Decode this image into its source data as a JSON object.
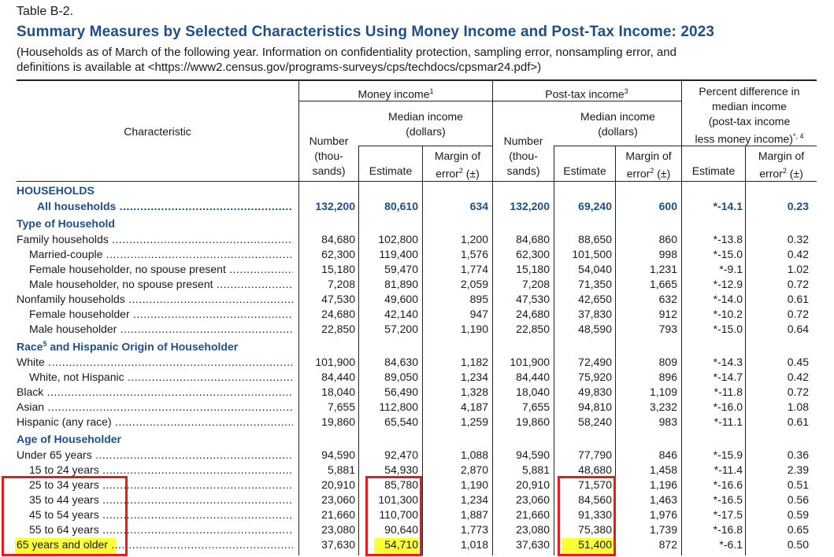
{
  "table_number": "Table B-2.",
  "title": "Summary Measures by Selected Characteristics Using Money Income and Post-Tax Income: 2023",
  "subtitle_line1": "(Households as of March of the following year. Information on confidentiality protection, sampling error, nonsampling error, and",
  "subtitle_line2": "definitions is available at <https://www2.census.gov/programs-surveys/cps/techdocs/cpsmar24.pdf>)",
  "headers": {
    "characteristic": "Characteristic",
    "money_income": "Money income",
    "money_income_note": "1",
    "post_tax_income": "Post-tax income",
    "post_tax_note": "3",
    "median_income": "Median income",
    "dollars": "(dollars)",
    "number_l1": "Number",
    "number_l2": "(thou-",
    "number_l3": "sands)",
    "estimate": "Estimate",
    "margin_l1": "Margin of",
    "margin_l2": "error",
    "margin_note": "2",
    "margin_pm": " (±)",
    "pct_l1": "Percent difference in",
    "pct_l2": "median income",
    "pct_l3": "(post-tax income",
    "pct_l4": "less money income)",
    "pct_note": "*, 4"
  },
  "sections": {
    "households": "HOUSEHOLDS",
    "type": "Type of Household",
    "race": "Race",
    "race_note": "5",
    "race_rest": " and Hispanic Origin of Householder",
    "age": "Age of Householder"
  },
  "rows": [
    {
      "label": "All households",
      "n": "132,200",
      "me": "80,610",
      "mm": "634",
      "pn": "132,200",
      "pe": "69,240",
      "pm": "600",
      "de": "*-14.1",
      "dm": "0.23"
    },
    {
      "label": "Family households",
      "n": "84,680",
      "me": "102,800",
      "mm": "1,200",
      "pn": "84,680",
      "pe": "88,650",
      "pm": "860",
      "de": "*-13.8",
      "dm": "0.32"
    },
    {
      "label": "Married-couple",
      "n": "62,300",
      "me": "119,400",
      "mm": "1,576",
      "pn": "62,300",
      "pe": "101,500",
      "pm": "998",
      "de": "*-15.0",
      "dm": "0.42"
    },
    {
      "label": "Female householder, no spouse present",
      "n": "15,180",
      "me": "59,470",
      "mm": "1,774",
      "pn": "15,180",
      "pe": "54,040",
      "pm": "1,231",
      "de": "*-9.1",
      "dm": "1.02"
    },
    {
      "label": "Male householder, no spouse present",
      "n": "7,208",
      "me": "81,890",
      "mm": "2,059",
      "pn": "7,208",
      "pe": "71,350",
      "pm": "1,665",
      "de": "*-12.9",
      "dm": "0.72"
    },
    {
      "label": "Nonfamily households",
      "n": "47,530",
      "me": "49,600",
      "mm": "895",
      "pn": "47,530",
      "pe": "42,650",
      "pm": "632",
      "de": "*-14.0",
      "dm": "0.61"
    },
    {
      "label": "Female householder",
      "n": "24,680",
      "me": "42,140",
      "mm": "947",
      "pn": "24,680",
      "pe": "37,830",
      "pm": "912",
      "de": "*-10.2",
      "dm": "0.72"
    },
    {
      "label": "Male householder",
      "n": "22,850",
      "me": "57,200",
      "mm": "1,190",
      "pn": "22,850",
      "pe": "48,590",
      "pm": "793",
      "de": "*-15.0",
      "dm": "0.64"
    },
    {
      "label": "White",
      "n": "101,900",
      "me": "84,630",
      "mm": "1,182",
      "pn": "101,900",
      "pe": "72,490",
      "pm": "809",
      "de": "*-14.3",
      "dm": "0.45"
    },
    {
      "label": "White, not Hispanic",
      "n": "84,440",
      "me": "89,050",
      "mm": "1,234",
      "pn": "84,440",
      "pe": "75,920",
      "pm": "896",
      "de": "*-14.7",
      "dm": "0.42"
    },
    {
      "label": "Black",
      "n": "18,040",
      "me": "56,490",
      "mm": "1,328",
      "pn": "18,040",
      "pe": "49,830",
      "pm": "1,109",
      "de": "*-11.8",
      "dm": "0.72"
    },
    {
      "label": "Asian",
      "n": "7,655",
      "me": "112,800",
      "mm": "4,187",
      "pn": "7,655",
      "pe": "94,810",
      "pm": "3,232",
      "de": "*-16.0",
      "dm": "1.08"
    },
    {
      "label": "Hispanic (any race)",
      "n": "19,860",
      "me": "65,540",
      "mm": "1,259",
      "pn": "19,860",
      "pe": "58,240",
      "pm": "983",
      "de": "*-11.1",
      "dm": "0.61"
    },
    {
      "label": "Under 65 years",
      "n": "94,590",
      "me": "92,470",
      "mm": "1,088",
      "pn": "94,590",
      "pe": "77,790",
      "pm": "846",
      "de": "*-15.9",
      "dm": "0.36"
    },
    {
      "label": "15 to 24 years",
      "n": "5,881",
      "me": "54,930",
      "mm": "2,870",
      "pn": "5,881",
      "pe": "48,680",
      "pm": "1,458",
      "de": "*-11.4",
      "dm": "2.39"
    },
    {
      "label": "25 to 34 years",
      "n": "20,910",
      "me": "85,780",
      "mm": "1,190",
      "pn": "20,910",
      "pe": "71,570",
      "pm": "1,196",
      "de": "*-16.6",
      "dm": "0.51"
    },
    {
      "label": "35 to 44 years",
      "n": "23,060",
      "me": "101,300",
      "mm": "1,234",
      "pn": "23,060",
      "pe": "84,560",
      "pm": "1,463",
      "de": "*-16.5",
      "dm": "0.56"
    },
    {
      "label": "45 to 54 years",
      "n": "21,660",
      "me": "110,700",
      "mm": "1,887",
      "pn": "21,660",
      "pe": "91,330",
      "pm": "1,976",
      "de": "*-17.5",
      "dm": "0.59"
    },
    {
      "label": "55 to 64 years",
      "n": "23,080",
      "me": "90,640",
      "mm": "1,773",
      "pn": "23,080",
      "pe": "75,380",
      "pm": "1,739",
      "de": "*-16.8",
      "dm": "0.65"
    },
    {
      "label": "65 years and older",
      "n": "37,630",
      "me": "54,710",
      "mm": "1,018",
      "pn": "37,630",
      "pe": "51,400",
      "pm": "872",
      "de": "*-6.1",
      "dm": "0.50"
    }
  ],
  "colors": {
    "title_blue": "#1f4e8c",
    "annotation_red": "#e41c1c",
    "highlight_yellow": "#ffff33"
  }
}
